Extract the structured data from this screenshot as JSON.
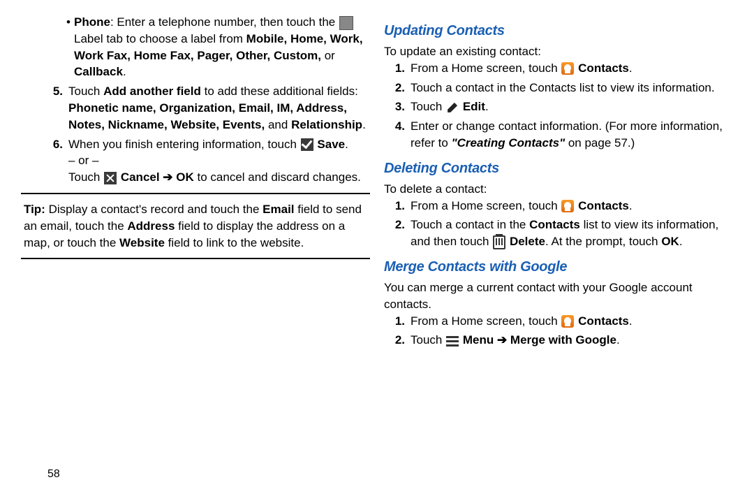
{
  "page_number": "58",
  "left": {
    "phone_bullet_pre": "Phone",
    "phone_bullet_text1": ": Enter a telephone number, then touch the ",
    "phone_bullet_text2": " Label tab to choose a label from ",
    "phone_labels": "Mobile, Home, Work, Work Fax, Home Fax, Pager, Other, Custom, ",
    "phone_or": "or ",
    "phone_callback": "Callback",
    "step5_pre": "Touch ",
    "step5_b1": "Add another field",
    "step5_mid": " to add these additional fields: ",
    "step5_fields": "Phonetic name, Organization, Email, IM, Address, Notes, Nickname, Website, Events, ",
    "step5_and": "and ",
    "step5_rel": "Relationship",
    "step6_text1": "When you finish entering information, touch ",
    "step6_save": "Save",
    "step6_or": "– or –",
    "step6_text2a": "Touch ",
    "step6_cancel": "Cancel",
    "step6_arrow": " ➔ ",
    "step6_ok": "OK",
    "step6_text2b": " to cancel and discard changes.",
    "tip_label": "Tip: ",
    "tip_text1": "Display a contact's record and touch the ",
    "tip_email": "Email",
    "tip_text2": " field to send an email, touch the ",
    "tip_address": "Address",
    "tip_text3": " field to display the address on a map, or touch the ",
    "tip_website": "Website",
    "tip_text4": " field to link to the website."
  },
  "right": {
    "h_update": "Updating Contacts",
    "update_intro": "To update an existing contact:",
    "u1_a": "From a Home screen, touch ",
    "u1_contacts": "Contacts",
    "u2": "Touch a contact in the Contacts list to view its information.",
    "u3_a": "Touch ",
    "u3_edit": "Edit",
    "u4_a": "Enter or change contact information. (For more information, refer to ",
    "u4_ref": "\"Creating Contacts\"",
    "u4_b": " on page 57.)",
    "h_delete": "Deleting Contacts",
    "delete_intro": "To delete a contact:",
    "d1_a": "From a Home screen, touch ",
    "d1_contacts": "Contacts",
    "d2_a": "Touch a contact in the ",
    "d2_b": "Contacts",
    "d2_c": " list to view its information, and then touch ",
    "d2_delete": "Delete",
    "d2_d": ". At the prompt, touch ",
    "d2_ok": "OK",
    "h_merge": "Merge Contacts with Google",
    "merge_intro": "You can merge a current contact with your Google account contacts.",
    "m1_a": "From a Home screen, touch ",
    "m1_contacts": "Contacts",
    "m2_a": "Touch ",
    "m2_menu": "Menu",
    "m2_arrow": " ➔ ",
    "m2_merge": "Merge with Google"
  }
}
